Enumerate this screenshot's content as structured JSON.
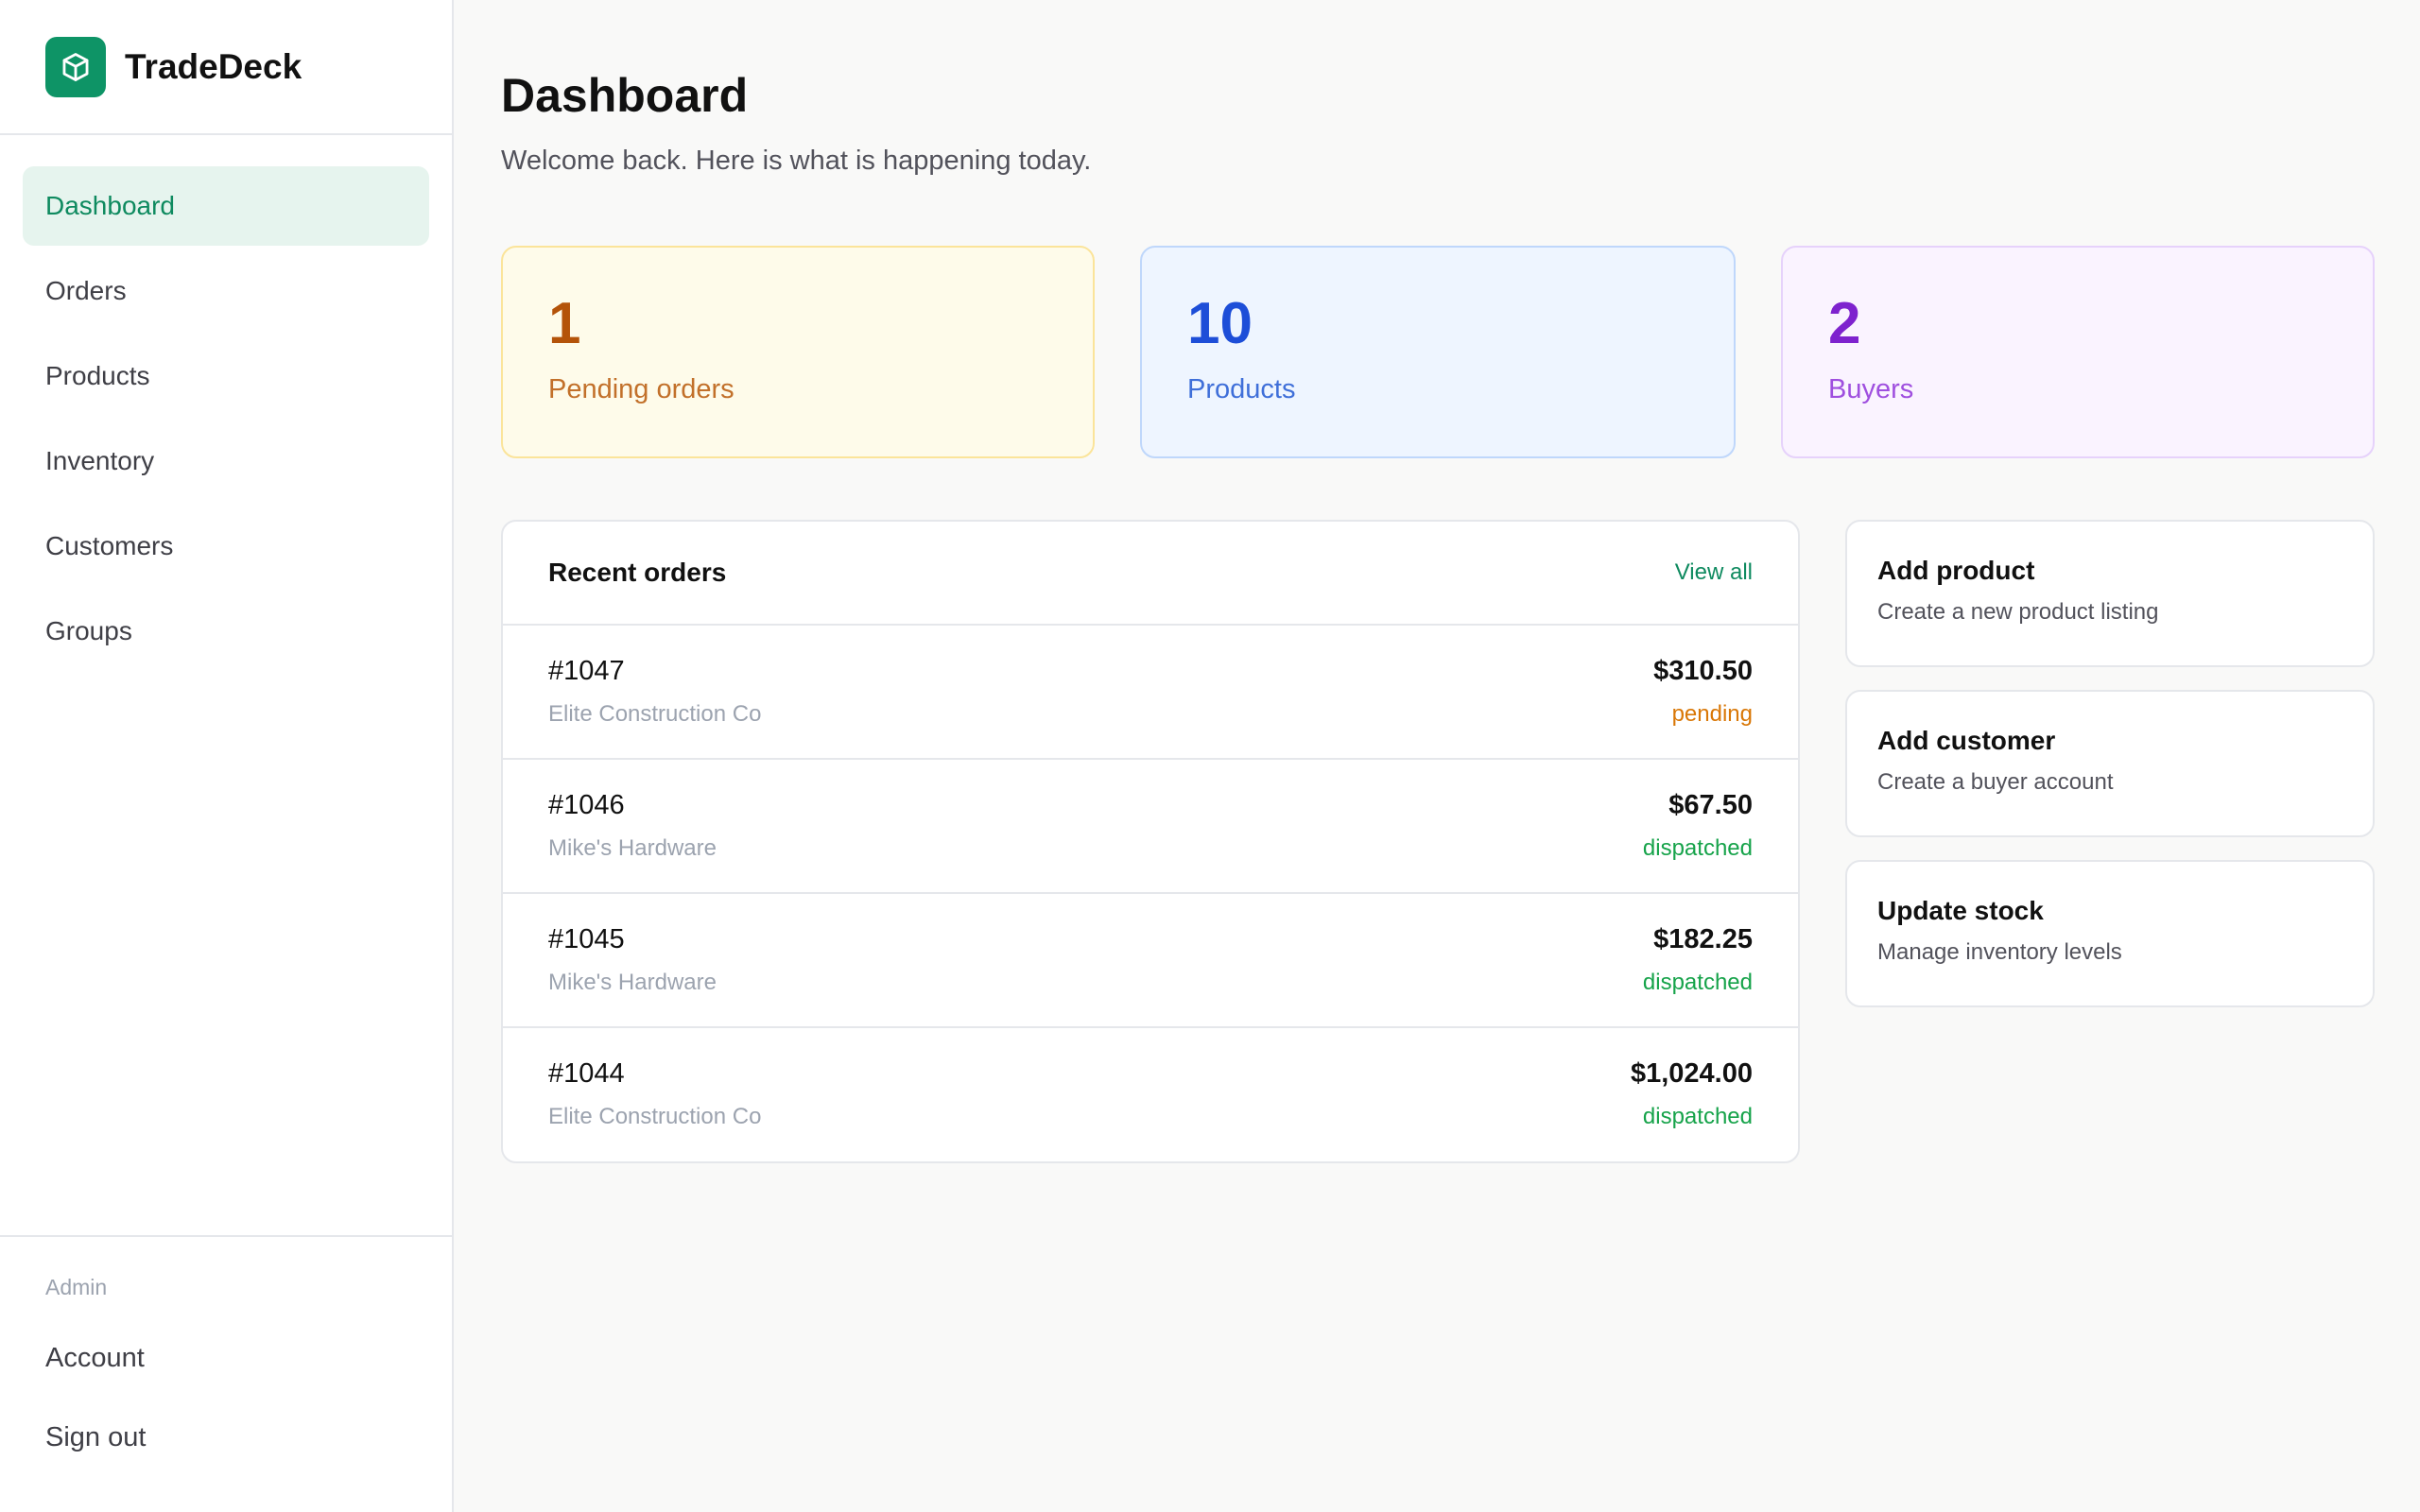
{
  "app": {
    "name": "TradeDeck",
    "logo_icon": "box-icon",
    "accent_color": "#0e9466"
  },
  "sidebar": {
    "items": [
      {
        "label": "Dashboard",
        "active": true
      },
      {
        "label": "Orders",
        "active": false
      },
      {
        "label": "Products",
        "active": false
      },
      {
        "label": "Inventory",
        "active": false
      },
      {
        "label": "Customers",
        "active": false
      },
      {
        "label": "Groups",
        "active": false
      }
    ],
    "section_label": "Admin",
    "account_label": "Account",
    "signout_label": "Sign out"
  },
  "header": {
    "title": "Dashboard",
    "subtitle": "Welcome back. Here is what is happening today."
  },
  "stats": [
    {
      "value": "1",
      "label": "Pending orders",
      "color": "#b45309"
    },
    {
      "value": "10",
      "label": "Products",
      "color": "#1d4ed8"
    },
    {
      "value": "2",
      "label": "Buyers",
      "color": "#7e22ce"
    }
  ],
  "orders": {
    "title": "Recent orders",
    "view_all": "View all",
    "rows": [
      {
        "id": "#1047",
        "customer": "Elite Construction Co",
        "amount": "$310.50",
        "status": "pending"
      },
      {
        "id": "#1046",
        "customer": "Mike's Hardware",
        "amount": "$67.50",
        "status": "dispatched"
      },
      {
        "id": "#1045",
        "customer": "Mike's Hardware",
        "amount": "$182.25",
        "status": "dispatched"
      },
      {
        "id": "#1044",
        "customer": "Elite Construction Co",
        "amount": "$1,024.00",
        "status": "dispatched"
      }
    ]
  },
  "actions": [
    {
      "title": "Add product",
      "description": "Create a new product listing"
    },
    {
      "title": "Add customer",
      "description": "Create a buyer account"
    },
    {
      "title": "Update stock",
      "description": "Manage inventory levels"
    }
  ]
}
